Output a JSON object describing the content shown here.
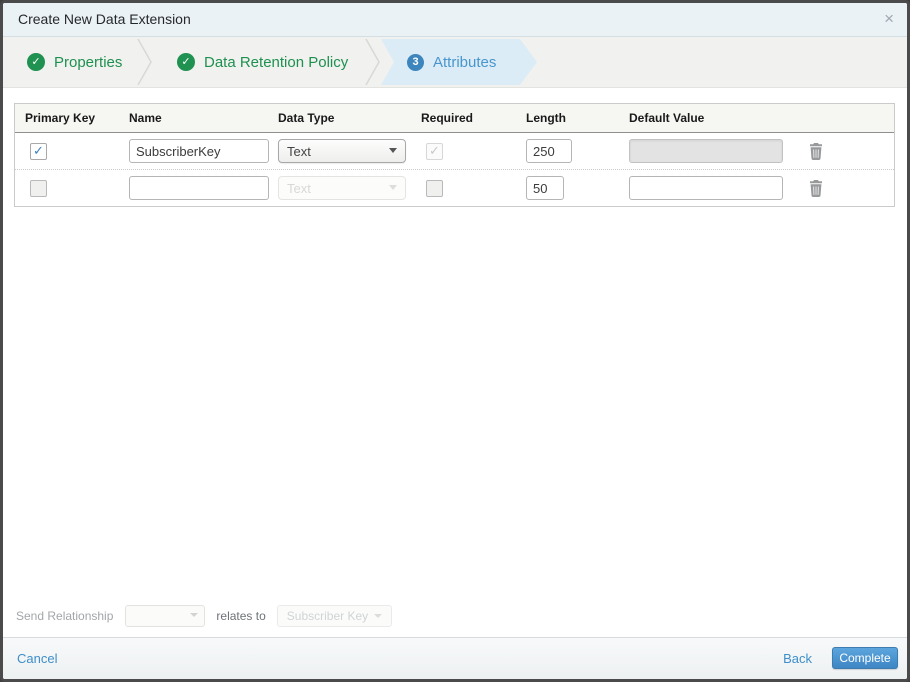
{
  "dialog": {
    "title": "Create New Data Extension",
    "close_glyph": "×"
  },
  "steps": [
    {
      "label": "Properties",
      "status": "complete"
    },
    {
      "label": "Data Retention Policy",
      "status": "complete"
    },
    {
      "label": "Attributes",
      "status": "current",
      "number": "3"
    }
  ],
  "table": {
    "columns": [
      "Primary Key",
      "Name",
      "Data Type",
      "Required",
      "Length",
      "Default Value"
    ],
    "rows": [
      {
        "primary_key": true,
        "primary_key_disabled": false,
        "name": "SubscriberKey",
        "data_type": "Text",
        "data_type_disabled": false,
        "required": true,
        "required_disabled": true,
        "length": "250",
        "default_value": "",
        "default_disabled": true
      },
      {
        "primary_key": false,
        "primary_key_disabled": true,
        "name": "",
        "data_type": "Text",
        "data_type_disabled": true,
        "required": false,
        "required_disabled": true,
        "length": "50",
        "default_value": "",
        "default_disabled": false
      }
    ]
  },
  "send_relationship": {
    "label": "Send Relationship",
    "relation_value": "",
    "relates_to_label": "relates to",
    "target_field": "Subscriber Key"
  },
  "footer": {
    "cancel_label": "Cancel",
    "back_label": "Back",
    "complete_label": "Complete"
  },
  "colors": {
    "step_complete_green": "#1f9150",
    "step_current_blue": "#4896cd",
    "step_current_bg": "#dcecf7",
    "accent_blue": "#3e8ec9",
    "complete_button_blue": "#4a94d0",
    "titlebar_bg": "#ebf2f6"
  }
}
